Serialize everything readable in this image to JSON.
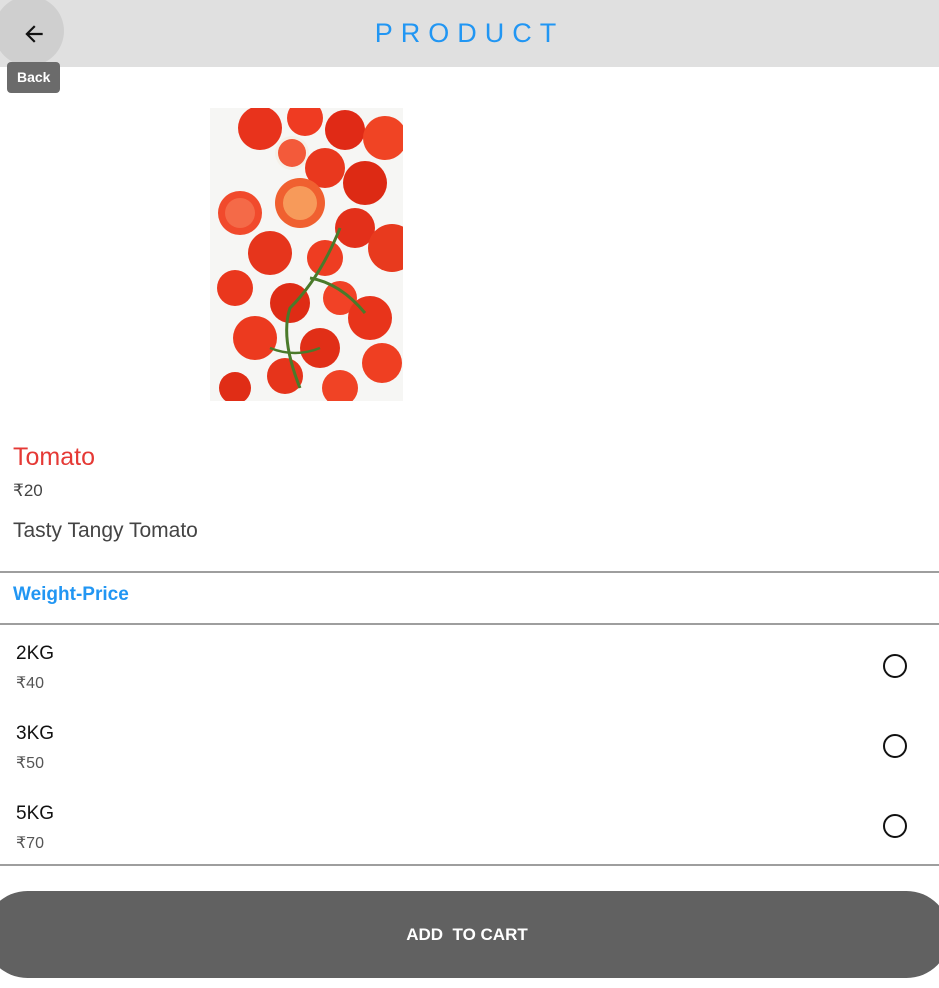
{
  "header": {
    "title": "PRODUCT",
    "back_tooltip": "Back",
    "back_icon": "arrow-back-icon",
    "title_color": "#2196f3",
    "bar_color": "#e0e0e0"
  },
  "product": {
    "name": "Tomato",
    "price": "₹20",
    "description": "Tasty Tangy Tomato",
    "name_color": "#e53935"
  },
  "weight_price": {
    "title": "Weight-Price",
    "options": [
      {
        "weight": "2KG",
        "price": "₹40",
        "selected": false
      },
      {
        "weight": "3KG",
        "price": "₹50",
        "selected": false
      },
      {
        "weight": "5KG",
        "price": "₹70",
        "selected": false
      }
    ]
  },
  "cart": {
    "label": "ADD  TO CART",
    "color": "#616161"
  }
}
